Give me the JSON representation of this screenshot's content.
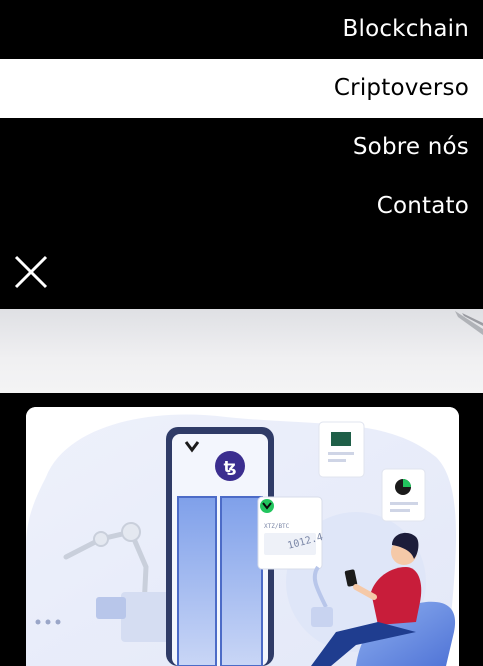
{
  "menu": {
    "items": [
      {
        "label": "Blockchain",
        "active": false
      },
      {
        "label": "Criptoverso",
        "active": true
      },
      {
        "label": "Sobre nós",
        "active": false
      },
      {
        "label": "Contato",
        "active": false
      }
    ]
  },
  "icons": {
    "close": "close-icon"
  },
  "illustration": {
    "screen_label": "XTZ/BTC",
    "screen_value": "1012.4"
  },
  "colors": {
    "background": "#000000",
    "active_item_bg": "#ffffff",
    "accent_purple": "#3b2e8f",
    "accent_green": "#22c55e",
    "person_shirt": "#c81d3a"
  }
}
